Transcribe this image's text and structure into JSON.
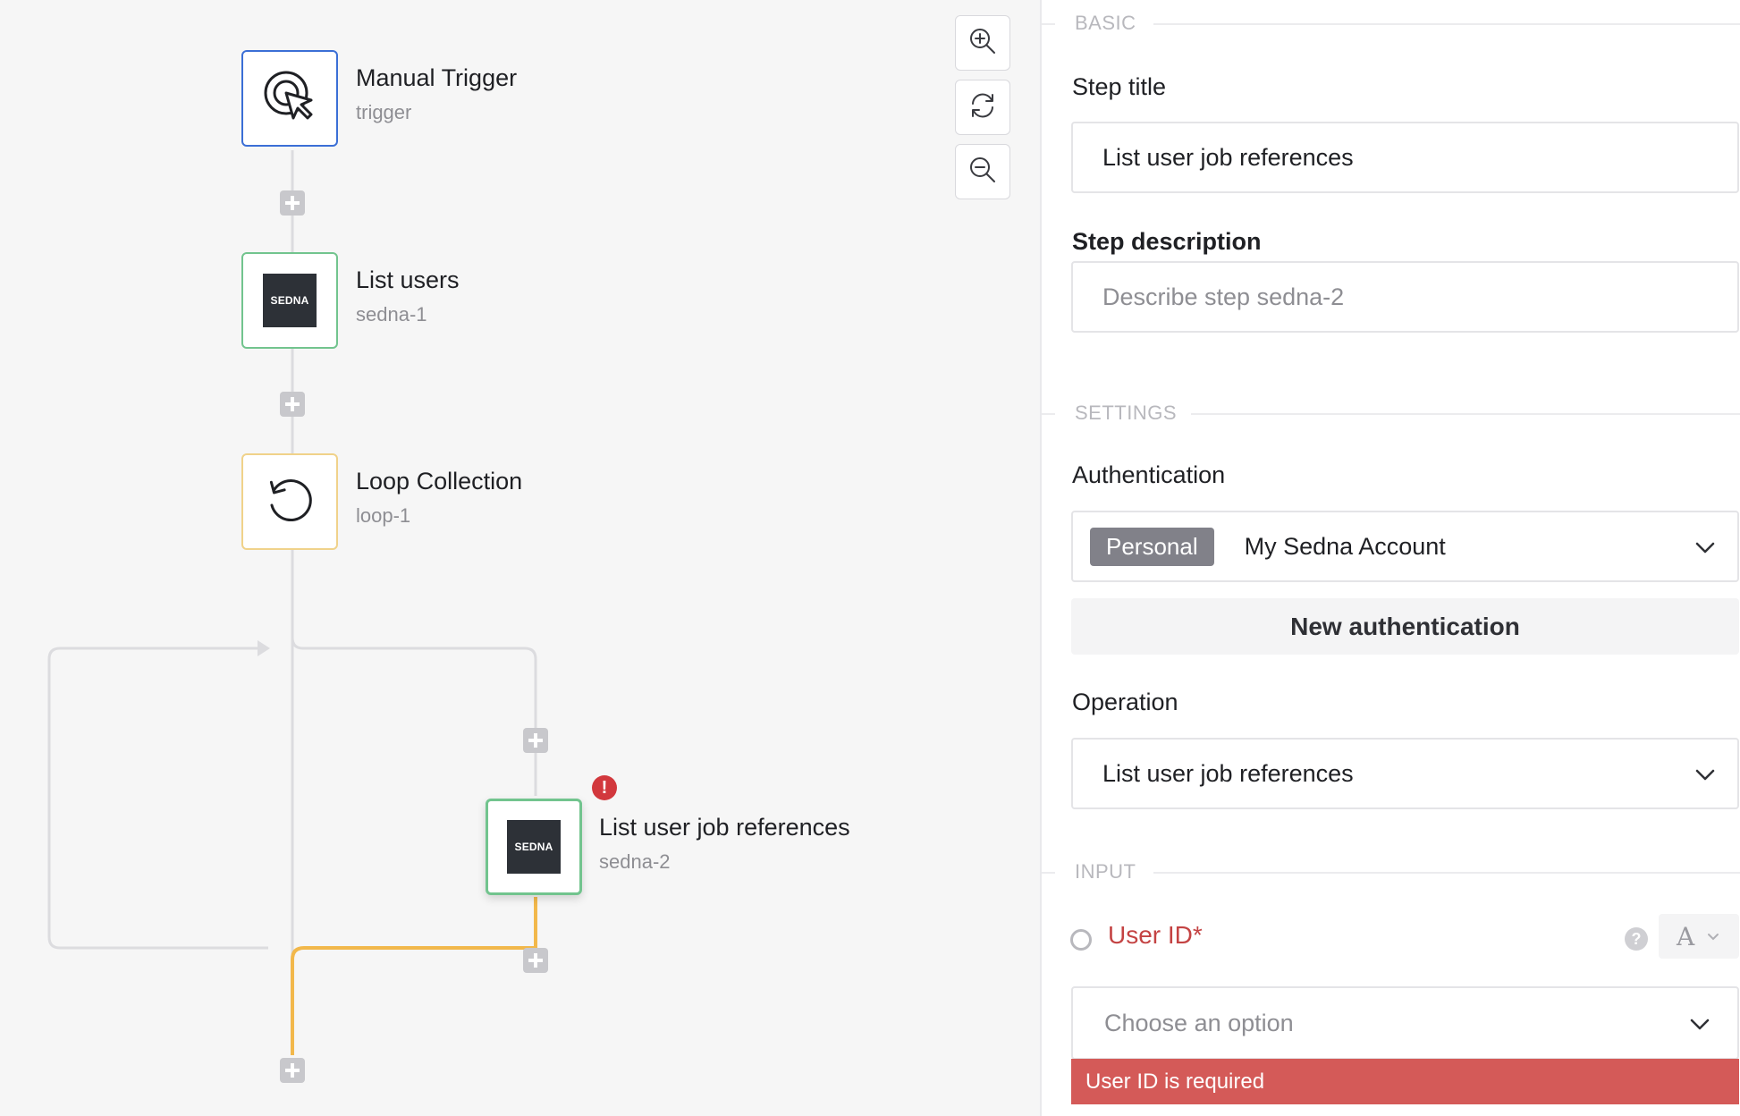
{
  "canvas": {
    "nodes": [
      {
        "title": "Manual Trigger",
        "subtitle": "trigger",
        "icon": "cursor-click-icon",
        "color": "#3b6fd6"
      },
      {
        "title": "List users",
        "subtitle": "sedna-1",
        "icon": "sedna-logo",
        "logo_text": "SEDNA",
        "color": "#72c48e"
      },
      {
        "title": "Loop Collection",
        "subtitle": "loop-1",
        "icon": "loop-icon",
        "color": "#f0d28a"
      },
      {
        "title": "List user job references",
        "subtitle": "sedna-2",
        "icon": "sedna-logo",
        "logo_text": "SEDNA",
        "color": "#72c48e",
        "has_error": true
      }
    ],
    "error_badge": "!",
    "zoom_controls": [
      "zoom-in-icon",
      "reset-icon",
      "zoom-out-icon"
    ]
  },
  "panel": {
    "sections": {
      "basic": "BASIC",
      "settings": "SETTINGS",
      "input": "INPUT"
    },
    "step_title": {
      "label": "Step title",
      "value": "List user job references"
    },
    "step_description": {
      "label": "Step description",
      "placeholder": "Describe step sedna-2"
    },
    "authentication": {
      "label": "Authentication",
      "badge": "Personal",
      "value": "My Sedna Account",
      "new_button": "New authentication"
    },
    "operation": {
      "label": "Operation",
      "value": "List user job references"
    },
    "user_id": {
      "label": "User ID*",
      "type_letter": "A",
      "placeholder": "Choose an option",
      "error": "User ID is required"
    }
  },
  "colors": {
    "error": "#d45a58",
    "wire": "#dcdcdf",
    "active_wire": "#f2b84b"
  }
}
